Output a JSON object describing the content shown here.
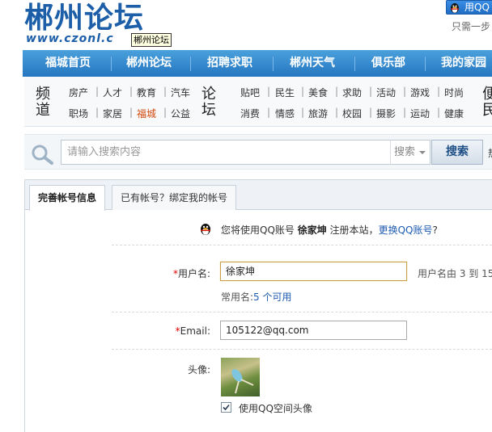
{
  "header": {
    "logo_cn": "郴州论坛",
    "logo_url": "www.czonl.c",
    "tooltip": "郴州论坛",
    "qq_login_label": "用QQ",
    "one_step_text": "只需一步"
  },
  "nav": {
    "items": [
      "福城首页",
      "郴州论坛",
      "招聘求职",
      "郴州天气",
      "俱乐部",
      "我的家园"
    ]
  },
  "channel": {
    "title_left": "频道",
    "title_mid": "论坛",
    "title_right": "便民",
    "row1_left": [
      "房产",
      "人才",
      "教育",
      "汽车"
    ],
    "row2_left": [
      "职场",
      "家居",
      "福城",
      "公益"
    ],
    "row1_right": [
      "贴吧",
      "民生",
      "美食",
      "求助",
      "活动",
      "游戏",
      "时尚"
    ],
    "row2_right": [
      "消费",
      "情感",
      "旅游",
      "校园",
      "摄影",
      "运动",
      "健康"
    ],
    "highlighted": "福城"
  },
  "search": {
    "placeholder": "请输入搜索内容",
    "select_value": "搜索",
    "button_label": "搜索",
    "extra": "热"
  },
  "tabs": {
    "active": "完善帐号信息",
    "inactive": "已有帐号？绑定我的帐号"
  },
  "notice": {
    "prefix": "您将使用QQ账号 ",
    "username": "徐家坤",
    "middle": " 注册本站，",
    "link": "更换QQ账号",
    "suffix": "?"
  },
  "form": {
    "username_label": "用户名:",
    "username_value": "徐家坤",
    "username_hint": "用户名由 3 到 15",
    "common_names_prefix": "常用名:",
    "common_names_link": "5 个可用",
    "email_label": "Email:",
    "email_value": "105122@qq.com",
    "avatar_label": "头像:",
    "use_qq_avatar_label": "使用QQ空间头像",
    "use_qq_avatar_checked": true
  },
  "colors": {
    "brand_blue": "#1c5ea8",
    "nav_blue": "#2576c0",
    "required_red": "#e60000",
    "link_blue": "#1d5bb0",
    "highlight_orange": "#d24a0e"
  }
}
